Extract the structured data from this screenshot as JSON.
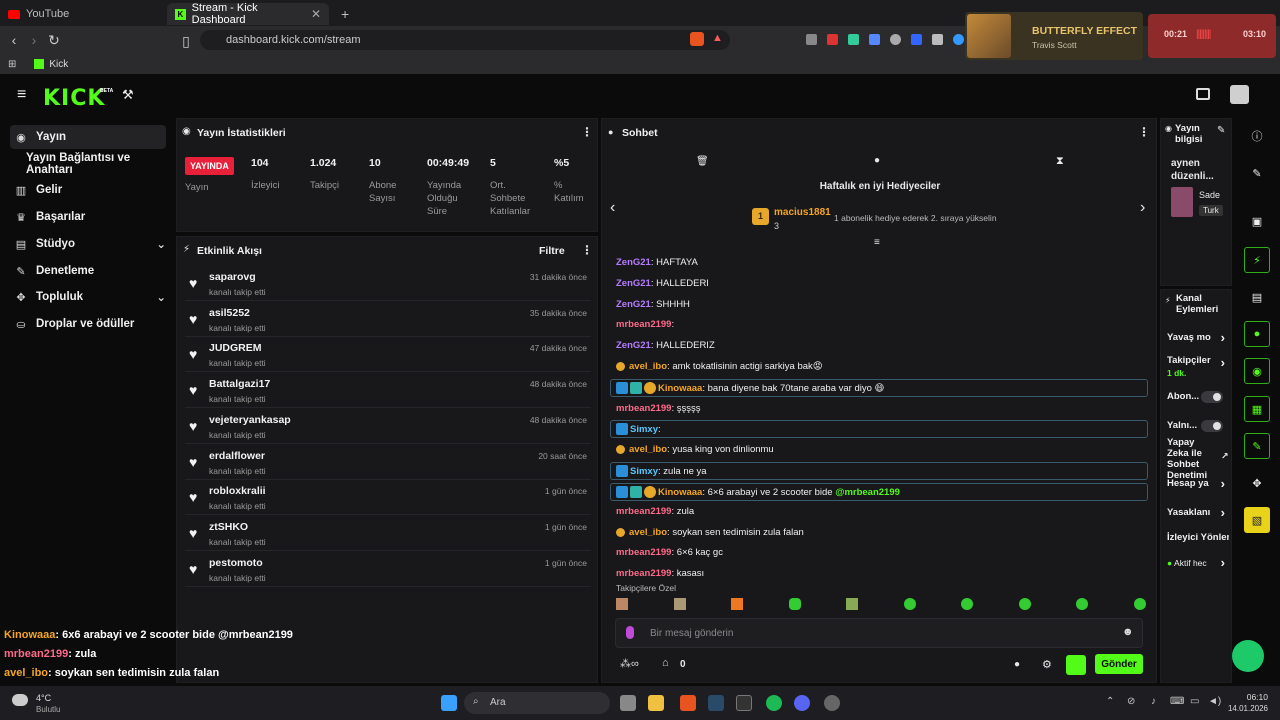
{
  "browser": {
    "tabs": [
      {
        "title": "YouTube",
        "active": false
      },
      {
        "title": "Stream - Kick Dashboard",
        "active": true
      }
    ],
    "new_tab": "+",
    "url": "dashboard.kick.com/stream",
    "bookmarks": [
      {
        "label": "Kick"
      }
    ]
  },
  "media": {
    "title": "BUTTERFLY EFFECT",
    "artist": "Travis Scott"
  },
  "recorder": {
    "elapsed": "00:21",
    "total": "03:10"
  },
  "header": {
    "logo": "KICK",
    "beta": "BETA"
  },
  "sidebar": {
    "items": [
      {
        "label": "Yayın",
        "active": true
      },
      {
        "label": "Yayın Bağlantısı ve Anahtarı"
      },
      {
        "label": "Gelir"
      },
      {
        "label": "Başarılar"
      },
      {
        "label": "Stüdyo",
        "expand": true
      },
      {
        "label": "Denetleme"
      },
      {
        "label": "Topluluk",
        "expand": true
      },
      {
        "label": "Droplar ve ödüller"
      }
    ]
  },
  "stats": {
    "title": "Yayın İstatistikleri",
    "live_badge": "YAYINDA",
    "live_label": "Yayın",
    "items": [
      {
        "value": "104",
        "label": "İzleyici"
      },
      {
        "value": "1.024",
        "label": "Takipçi"
      },
      {
        "value": "10",
        "label": "Abone Sayısı"
      },
      {
        "value": "00:49:49",
        "label": "Yayında Olduğu Süre"
      },
      {
        "value": "5",
        "label": "Ort. Sohbete Katılanlar"
      },
      {
        "value": "%5",
        "label": "% Katılım"
      }
    ]
  },
  "events": {
    "title": "Etkinlik Akışı",
    "filter": "Filtre",
    "items": [
      {
        "name": "saparovg",
        "action": "kanalı takip etti",
        "time": "31 dakika önce"
      },
      {
        "name": "asil5252",
        "action": "kanalı takip etti",
        "time": "35 dakika önce"
      },
      {
        "name": "JUDGREM",
        "action": "kanalı takip etti",
        "time": "47 dakika önce"
      },
      {
        "name": "Battalgazi17",
        "action": "kanalı takip etti",
        "time": "48 dakika önce"
      },
      {
        "name": "vejeteryankasap",
        "action": "kanalı takip etti",
        "time": "48 dakika önce"
      },
      {
        "name": "erdalflower",
        "action": "kanalı takip etti",
        "time": "20 saat önce"
      },
      {
        "name": "robloxkralii",
        "action": "kanalı takip etti",
        "time": "1 gün önce"
      },
      {
        "name": "ztSHKO",
        "action": "kanalı takip etti",
        "time": "1 gün önce"
      },
      {
        "name": "pestomoto",
        "action": "kanalı takip etti",
        "time": "1 gün önce"
      }
    ]
  },
  "chat": {
    "title": "Sohbet",
    "gifter_heading": "Haftalık en iyi Hediyeciler",
    "top_gifter": {
      "rank": "1",
      "name": "macius1881",
      "count": "3"
    },
    "gifter_note": "1 abonelik hediye ederek 2. sıraya yükselin",
    "messages": [
      {
        "user": "ZenG21",
        "text": "HAFTAYA",
        "color": "#b57cff"
      },
      {
        "user": "ZenG21",
        "text": "HALLEDERI",
        "color": "#b57cff"
      },
      {
        "user": "ZenG21",
        "text": "SHHHH",
        "color": "#b57cff"
      },
      {
        "user": "mrbean2199",
        "text": "",
        "color": "#ff6a8a"
      },
      {
        "user": "ZenG21",
        "text": "HALLEDERIZ",
        "color": "#b57cff"
      },
      {
        "user": "avel_ibo",
        "text": "amk tokatlisinin actigi sarkiya bak😡",
        "color": "#f5a623"
      },
      {
        "user": "Kinowaaa",
        "text": "bana diyene bak 70tane araba var diyo 😄",
        "color": "#f5a623",
        "highlight": true
      },
      {
        "user": "mrbean2199",
        "text": "şşşşş",
        "color": "#ff6a8a"
      },
      {
        "user": "Simxy",
        "text": "",
        "color": "#58c8ff",
        "highlight": true
      },
      {
        "user": "avel_ibo",
        "text": "yusa king von dinlionmu",
        "color": "#f5a623"
      },
      {
        "user": "Simxy",
        "text": "zula ne ya",
        "color": "#58c8ff",
        "highlight": true
      },
      {
        "user": "Kinowaaa",
        "text": "6×6 arabayi ve 2 scooter bide",
        "mention": "@mrbean2199",
        "color": "#f5a623",
        "highlight": true
      },
      {
        "user": "mrbean2199",
        "text": "zula",
        "color": "#ff6a8a"
      },
      {
        "user": "avel_ibo",
        "text": "soykan sen tedimisin zula falan",
        "color": "#f5a623"
      },
      {
        "user": "mrbean2199",
        "text": "6×6 kaç gc",
        "color": "#ff6a8a"
      },
      {
        "user": "mrbean2199",
        "text": "kasası",
        "color": "#ff6a8a"
      }
    ],
    "followers_only": "Takipçilere Özel",
    "input_placeholder": "Bir mesaj gönderin",
    "points": "0",
    "send": "Gönder"
  },
  "stream_info": {
    "title": "Yayın bilgisi",
    "text": "aynen düzenli...",
    "channel": "Sade",
    "tag": "Turk"
  },
  "channel_actions": {
    "title": "Kanal Eylemleri",
    "items": [
      {
        "label": "Yavaş mo",
        "type": "arrow"
      },
      {
        "label": "Takipçiler",
        "sub": "1 dk.",
        "type": "arrow"
      },
      {
        "label": "Abon...",
        "type": "toggle"
      },
      {
        "label": "Yalnı...",
        "type": "toggle"
      },
      {
        "label": "Yapay Zeka ile Sohbet Denetimi",
        "type": "external"
      },
      {
        "label": "Hesap ya",
        "type": "arrow"
      },
      {
        "label": "Yasaklanı",
        "type": "arrow"
      },
      {
        "label": "İzleyici Yönlen",
        "type": "none"
      },
      {
        "label": "Aktif hec",
        "type": "arrow"
      }
    ]
  },
  "overlay": [
    {
      "user": "Kinowaaa",
      "text": ": 6x6 arabayi ve 2 scooter bide @mrbean2199",
      "color": "#f5a623"
    },
    {
      "user": "mrbean2199",
      "text": ": zula",
      "color": "#ff6a8a"
    },
    {
      "user": "avel_ibo",
      "text": ": soykan sen tedimisin zula falan",
      "color": "#f5a623"
    },
    {
      "user": "mrbean2199",
      "text": ": 6x6 kaç gc",
      "color": "#ff6a8a"
    },
    {
      "user": "mrbean2199",
      "text": ": kasası",
      "color": "#ff6a8a"
    }
  ],
  "taskbar": {
    "search": "Ara",
    "time": "06:10",
    "date": "14.01.2026",
    "weather": "4°C",
    "weather_sub": "Bulutlu"
  },
  "colors": {
    "accent": "#53fc18",
    "live": "#e8203a",
    "panel": "#18181a"
  }
}
